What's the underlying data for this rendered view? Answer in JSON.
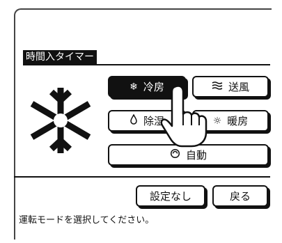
{
  "screen": {
    "title": "時間入タイマー",
    "status": "運転モードを選択してください。"
  },
  "modes": [
    {
      "label": "冷房",
      "icon": "snowflake-icon",
      "glyph": "❄",
      "selected": true
    },
    {
      "label": "送風",
      "icon": "fan-icon",
      "glyph": "⸗",
      "selected": false
    },
    {
      "label": "除湿",
      "icon": "droplet-icon",
      "glyph": "◊",
      "selected": false
    },
    {
      "label": "暖房",
      "icon": "sun-icon",
      "glyph": "☼",
      "selected": false
    },
    {
      "label": "自動",
      "icon": "auto-icon",
      "glyph": "⟳",
      "selected": false
    }
  ],
  "actions": {
    "no_setting": "設定なし",
    "back": "戻る"
  },
  "colors": {
    "ink": "#111111",
    "background": "#ffffff"
  }
}
